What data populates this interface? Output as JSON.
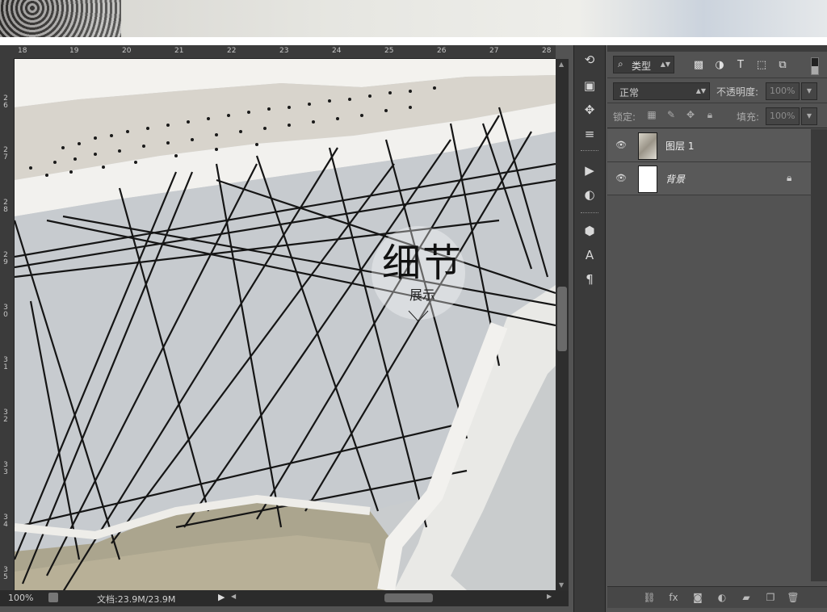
{
  "ruler": {
    "top_labels": [
      "18",
      "19",
      "20",
      "21",
      "22",
      "23",
      "24",
      "25",
      "26",
      "27",
      "28"
    ],
    "left_labels": [
      "26",
      "27",
      "28",
      "29",
      "30",
      "31",
      "32",
      "33",
      "34",
      "35"
    ]
  },
  "canvas": {
    "detail_title": "细节",
    "detail_subtitle": "展示"
  },
  "status": {
    "zoom": "100%",
    "doc_info": "文档:23.9M/23.9M"
  },
  "tools": {
    "icons": [
      "history-icon",
      "brush-preset-icon",
      "clone-source-icon",
      "adjust-icon",
      "play-icon",
      "color-wheel-icon",
      "3d-icon",
      "character-icon",
      "paragraph-icon"
    ]
  },
  "layers_panel": {
    "filter_label": "类型",
    "blend_mode": "正常",
    "opacity_label": "不透明度:",
    "opacity_value": "100%",
    "lock_label": "锁定:",
    "fill_label": "填充:",
    "fill_value": "100%",
    "layers": [
      {
        "name": "图层 1",
        "locked": false
      },
      {
        "name": "背景",
        "locked": true
      }
    ]
  },
  "colors": {
    "ps_bg": "#535353",
    "panel_dark": "#3a3a3a"
  }
}
